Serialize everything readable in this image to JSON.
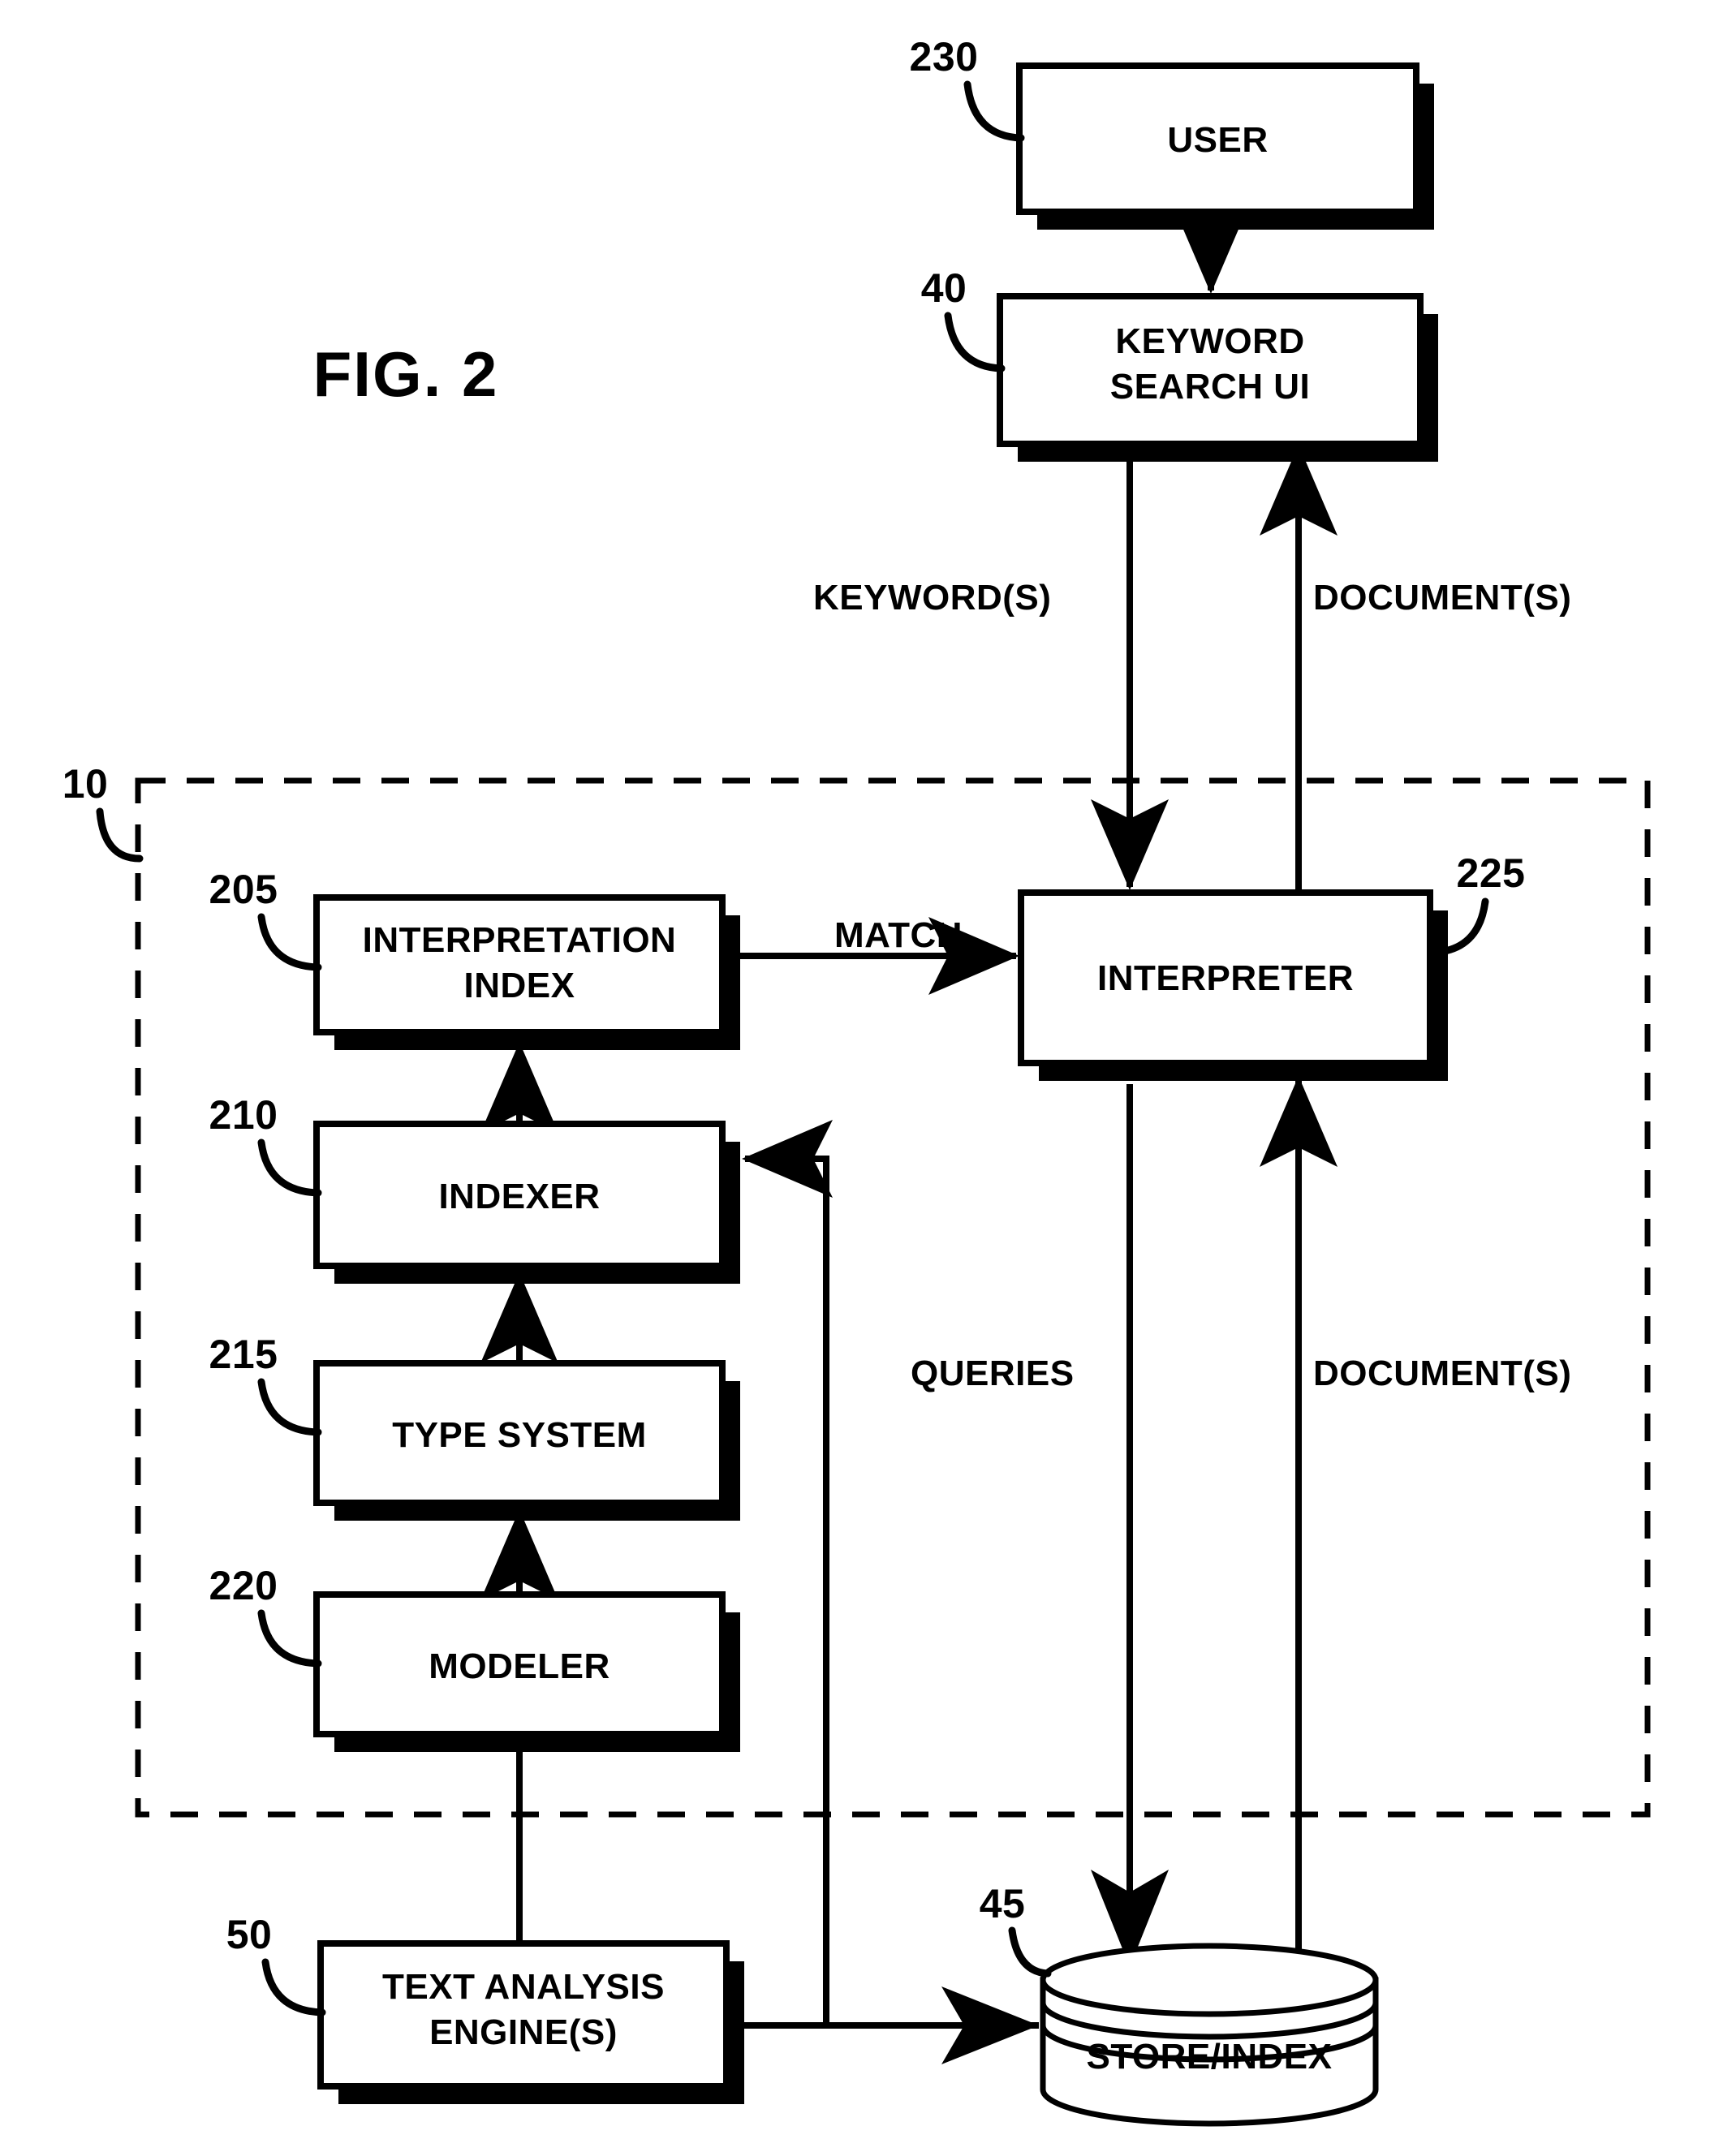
{
  "figure": {
    "title": "FIG. 2",
    "type": "patent-block-diagram"
  },
  "boxes": {
    "user": {
      "label": "USER",
      "ref": "230"
    },
    "keyword_search_ui": {
      "label_line1": "KEYWORD",
      "label_line2": "SEARCH UI",
      "ref": "40"
    },
    "interpretation_index": {
      "label_line1": "INTERPRETATION",
      "label_line2": "INDEX",
      "ref": "205"
    },
    "indexer": {
      "label": "INDEXER",
      "ref": "210"
    },
    "type_system": {
      "label": "TYPE SYSTEM",
      "ref": "215"
    },
    "modeler": {
      "label": "MODELER",
      "ref": "220"
    },
    "interpreter": {
      "label": "INTERPRETER",
      "ref": "225"
    },
    "text_analysis_engine": {
      "label_line1": "TEXT ANALYSIS",
      "label_line2": "ENGINE(S)",
      "ref": "50"
    },
    "store_index": {
      "label": "STORE/INDEX",
      "ref": "45"
    }
  },
  "system_boundary": {
    "ref": "10"
  },
  "flow_labels": {
    "keywords": "KEYWORD(S)",
    "documents_top": "DOCUMENT(S)",
    "match": "MATCH",
    "queries": "QUERIES",
    "documents_bottom": "DOCUMENT(S)"
  },
  "colors": {
    "line": "#000000",
    "fill": "#ffffff",
    "shadow": "#000000",
    "background": "#ffffff"
  }
}
